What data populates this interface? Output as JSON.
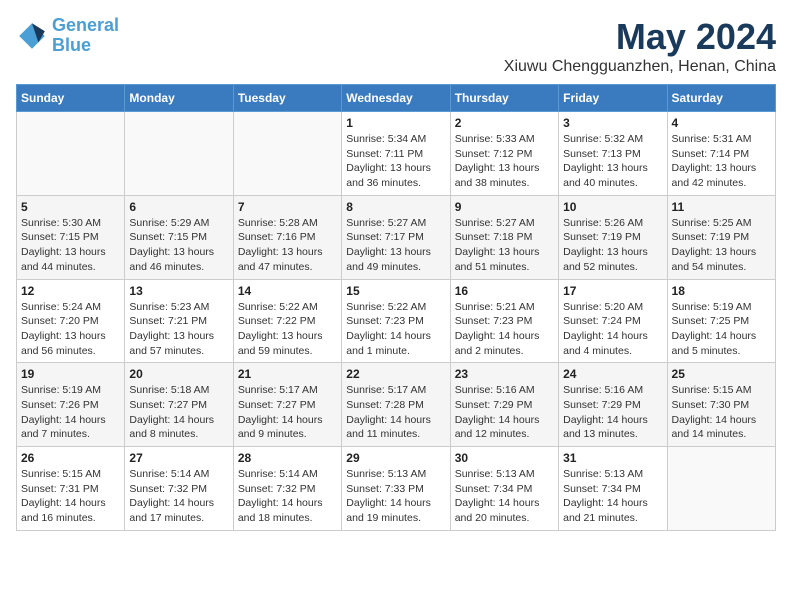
{
  "logo": {
    "line1": "General",
    "line2": "Blue"
  },
  "title": "May 2024",
  "subtitle": "Xiuwu Chengguanzhen, Henan, China",
  "days_header": [
    "Sunday",
    "Monday",
    "Tuesday",
    "Wednesday",
    "Thursday",
    "Friday",
    "Saturday"
  ],
  "weeks": [
    [
      {
        "day": "",
        "info": ""
      },
      {
        "day": "",
        "info": ""
      },
      {
        "day": "",
        "info": ""
      },
      {
        "day": "1",
        "info": "Sunrise: 5:34 AM\nSunset: 7:11 PM\nDaylight: 13 hours and 36 minutes."
      },
      {
        "day": "2",
        "info": "Sunrise: 5:33 AM\nSunset: 7:12 PM\nDaylight: 13 hours and 38 minutes."
      },
      {
        "day": "3",
        "info": "Sunrise: 5:32 AM\nSunset: 7:13 PM\nDaylight: 13 hours and 40 minutes."
      },
      {
        "day": "4",
        "info": "Sunrise: 5:31 AM\nSunset: 7:14 PM\nDaylight: 13 hours and 42 minutes."
      }
    ],
    [
      {
        "day": "5",
        "info": "Sunrise: 5:30 AM\nSunset: 7:15 PM\nDaylight: 13 hours and 44 minutes."
      },
      {
        "day": "6",
        "info": "Sunrise: 5:29 AM\nSunset: 7:15 PM\nDaylight: 13 hours and 46 minutes."
      },
      {
        "day": "7",
        "info": "Sunrise: 5:28 AM\nSunset: 7:16 PM\nDaylight: 13 hours and 47 minutes."
      },
      {
        "day": "8",
        "info": "Sunrise: 5:27 AM\nSunset: 7:17 PM\nDaylight: 13 hours and 49 minutes."
      },
      {
        "day": "9",
        "info": "Sunrise: 5:27 AM\nSunset: 7:18 PM\nDaylight: 13 hours and 51 minutes."
      },
      {
        "day": "10",
        "info": "Sunrise: 5:26 AM\nSunset: 7:19 PM\nDaylight: 13 hours and 52 minutes."
      },
      {
        "day": "11",
        "info": "Sunrise: 5:25 AM\nSunset: 7:19 PM\nDaylight: 13 hours and 54 minutes."
      }
    ],
    [
      {
        "day": "12",
        "info": "Sunrise: 5:24 AM\nSunset: 7:20 PM\nDaylight: 13 hours and 56 minutes."
      },
      {
        "day": "13",
        "info": "Sunrise: 5:23 AM\nSunset: 7:21 PM\nDaylight: 13 hours and 57 minutes."
      },
      {
        "day": "14",
        "info": "Sunrise: 5:22 AM\nSunset: 7:22 PM\nDaylight: 13 hours and 59 minutes."
      },
      {
        "day": "15",
        "info": "Sunrise: 5:22 AM\nSunset: 7:23 PM\nDaylight: 14 hours and 1 minute."
      },
      {
        "day": "16",
        "info": "Sunrise: 5:21 AM\nSunset: 7:23 PM\nDaylight: 14 hours and 2 minutes."
      },
      {
        "day": "17",
        "info": "Sunrise: 5:20 AM\nSunset: 7:24 PM\nDaylight: 14 hours and 4 minutes."
      },
      {
        "day": "18",
        "info": "Sunrise: 5:19 AM\nSunset: 7:25 PM\nDaylight: 14 hours and 5 minutes."
      }
    ],
    [
      {
        "day": "19",
        "info": "Sunrise: 5:19 AM\nSunset: 7:26 PM\nDaylight: 14 hours and 7 minutes."
      },
      {
        "day": "20",
        "info": "Sunrise: 5:18 AM\nSunset: 7:27 PM\nDaylight: 14 hours and 8 minutes."
      },
      {
        "day": "21",
        "info": "Sunrise: 5:17 AM\nSunset: 7:27 PM\nDaylight: 14 hours and 9 minutes."
      },
      {
        "day": "22",
        "info": "Sunrise: 5:17 AM\nSunset: 7:28 PM\nDaylight: 14 hours and 11 minutes."
      },
      {
        "day": "23",
        "info": "Sunrise: 5:16 AM\nSunset: 7:29 PM\nDaylight: 14 hours and 12 minutes."
      },
      {
        "day": "24",
        "info": "Sunrise: 5:16 AM\nSunset: 7:29 PM\nDaylight: 14 hours and 13 minutes."
      },
      {
        "day": "25",
        "info": "Sunrise: 5:15 AM\nSunset: 7:30 PM\nDaylight: 14 hours and 14 minutes."
      }
    ],
    [
      {
        "day": "26",
        "info": "Sunrise: 5:15 AM\nSunset: 7:31 PM\nDaylight: 14 hours and 16 minutes."
      },
      {
        "day": "27",
        "info": "Sunrise: 5:14 AM\nSunset: 7:32 PM\nDaylight: 14 hours and 17 minutes."
      },
      {
        "day": "28",
        "info": "Sunrise: 5:14 AM\nSunset: 7:32 PM\nDaylight: 14 hours and 18 minutes."
      },
      {
        "day": "29",
        "info": "Sunrise: 5:13 AM\nSunset: 7:33 PM\nDaylight: 14 hours and 19 minutes."
      },
      {
        "day": "30",
        "info": "Sunrise: 5:13 AM\nSunset: 7:34 PM\nDaylight: 14 hours and 20 minutes."
      },
      {
        "day": "31",
        "info": "Sunrise: 5:13 AM\nSunset: 7:34 PM\nDaylight: 14 hours and 21 minutes."
      },
      {
        "day": "",
        "info": ""
      }
    ]
  ]
}
